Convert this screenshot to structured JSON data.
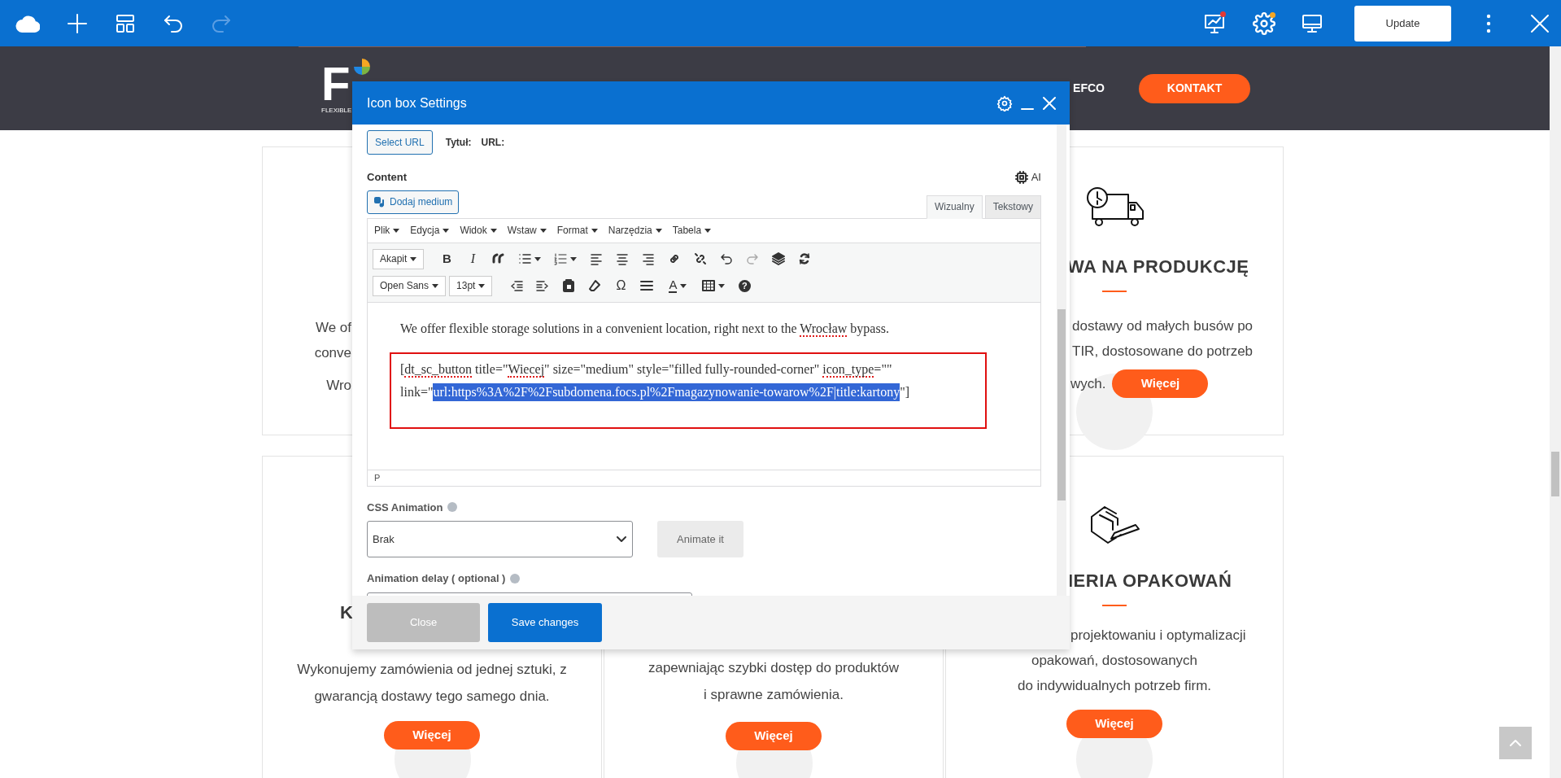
{
  "top_bar": {
    "update_button": "Update"
  },
  "header": {
    "logo_letter": "F",
    "logo_tagline": "FLEXIBLE",
    "nav_item": "EFCO",
    "contact_button": "KONTAKT"
  },
  "cards": [
    {
      "lines": [
        "We of",
        "conve",
        "Wro"
      ]
    },
    {
      "title": "WA NA PRODUKCJĘ",
      "lines": [
        "dostawy od małych busów po",
        "TIR, dostosowane do potrzeb",
        "wych."
      ],
      "button": "Więcej"
    },
    {
      "title": "K",
      "lines": [
        "Wykonujemy zamówienia od jednej sztuki, z",
        "gwarancją dostawy tego samego dnia."
      ],
      "button": "Więcej"
    },
    {
      "lines": [
        "zapewniając szybki dostęp do produktów",
        "i sprawne zamówienia."
      ],
      "button": "Więcej"
    },
    {
      "title": "IERIA OPAKOWAŃ",
      "lines": [
        "projektowaniu i optymalizacji",
        "opakowań, dostosowanych",
        "do indywidualnych potrzeb firm."
      ],
      "button": "Więcej"
    }
  ],
  "dialog": {
    "title": "Icon box Settings",
    "select_url_button": "Select URL",
    "title_label": "Tytuł:",
    "url_label": "URL:",
    "content_label": "Content",
    "ai_label": "AI",
    "add_media_button": "Dodaj medium",
    "tabs": [
      {
        "label": "Wizualny",
        "selected": true
      },
      {
        "label": "Tekstowy",
        "selected": false
      }
    ],
    "menu": [
      "Plik",
      "Edycja",
      "Widok",
      "Wstaw",
      "Format",
      "Narzędzia",
      "Tabela"
    ],
    "format_select": "Akapit",
    "font_select": "Open Sans",
    "size_select": "13pt",
    "glyphs": {
      "bold": "B",
      "italic": "I",
      "special_char": "Ω",
      "text_color": "A",
      "help": "?"
    },
    "paragraph": [
      {
        "text": "We offer flexible storage solutions in a convenient location, right next to the ",
        "misspelled": false,
        "selected": false
      },
      {
        "text": "Wrocław",
        "misspelled": true,
        "selected": false
      },
      {
        "text": " bypass.",
        "misspelled": false,
        "selected": false
      }
    ],
    "shortcode_lines": [
      [
        {
          "text": "[",
          "misspelled": false,
          "selected": false
        },
        {
          "text": "dt_sc_button",
          "misspelled": true,
          "selected": false
        },
        {
          "text": " title=\"",
          "misspelled": false,
          "selected": false
        },
        {
          "text": "Wiecej",
          "misspelled": true,
          "selected": false
        },
        {
          "text": "\" size=\"medium\" style=\"filled fully-rounded-corner\" ",
          "misspelled": false,
          "selected": false
        },
        {
          "text": "icon_type",
          "misspelled": true,
          "selected": false
        },
        {
          "text": "=\"\"",
          "misspelled": false,
          "selected": false
        }
      ],
      [
        {
          "text": "link=\"",
          "misspelled": false,
          "selected": false
        },
        {
          "text": "url:https%3A%2F%2Fsubdomena.focs.pl%2Fmagazynowanie-towarow%2F|title:kartony",
          "misspelled": false,
          "selected": true
        },
        {
          "text": "\"]",
          "misspelled": false,
          "selected": false
        }
      ]
    ],
    "status_path": "P",
    "css_animation_label": "CSS Animation",
    "css_animation_value": "Brak",
    "animate_button": "Animate it",
    "delay_label": "Animation delay ( optional )",
    "close_button": "Close",
    "save_button": "Save changes"
  }
}
